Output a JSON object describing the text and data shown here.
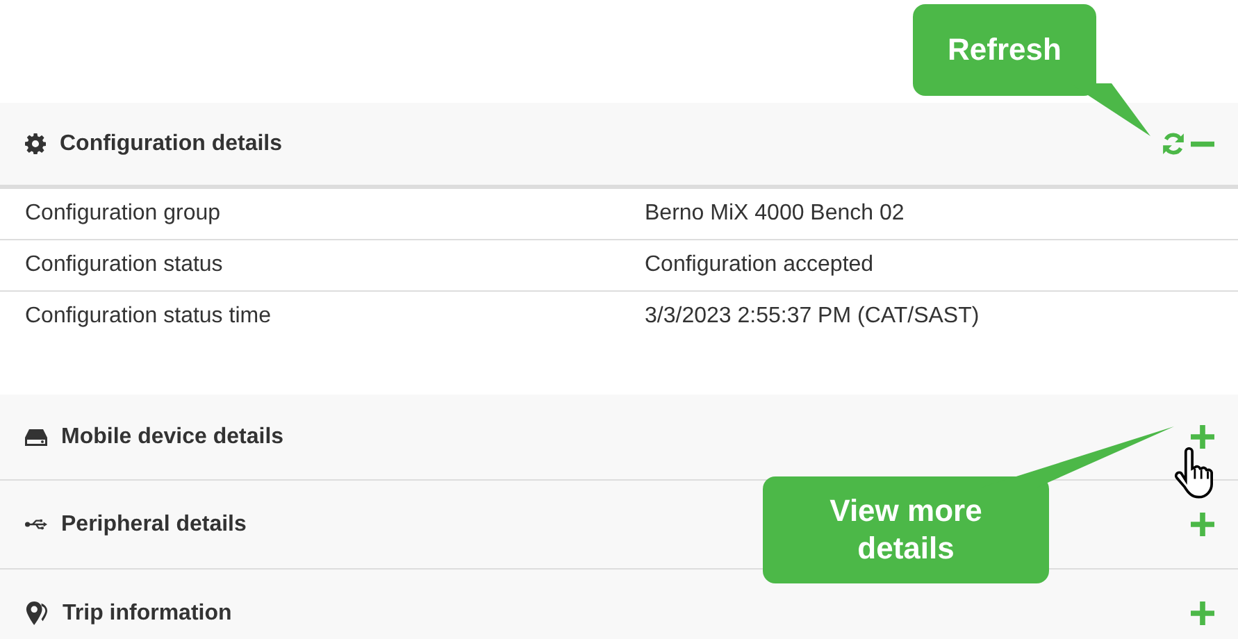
{
  "sections": [
    {
      "title": "Configuration details",
      "expanded": true,
      "rows": [
        {
          "label": "Configuration group",
          "value": "Berno MiX 4000 Bench 02"
        },
        {
          "label": "Configuration status",
          "value": "Configuration accepted"
        },
        {
          "label": "Configuration status time",
          "value": "3/3/2023 2:55:37 PM (CAT/SAST)"
        }
      ]
    },
    {
      "title": "Mobile device details",
      "expanded": false
    },
    {
      "title": "Peripheral details",
      "expanded": false
    },
    {
      "title": "Trip information",
      "expanded": false
    }
  ],
  "callouts": [
    {
      "text": "Refresh"
    },
    {
      "text": "View more details"
    }
  ]
}
